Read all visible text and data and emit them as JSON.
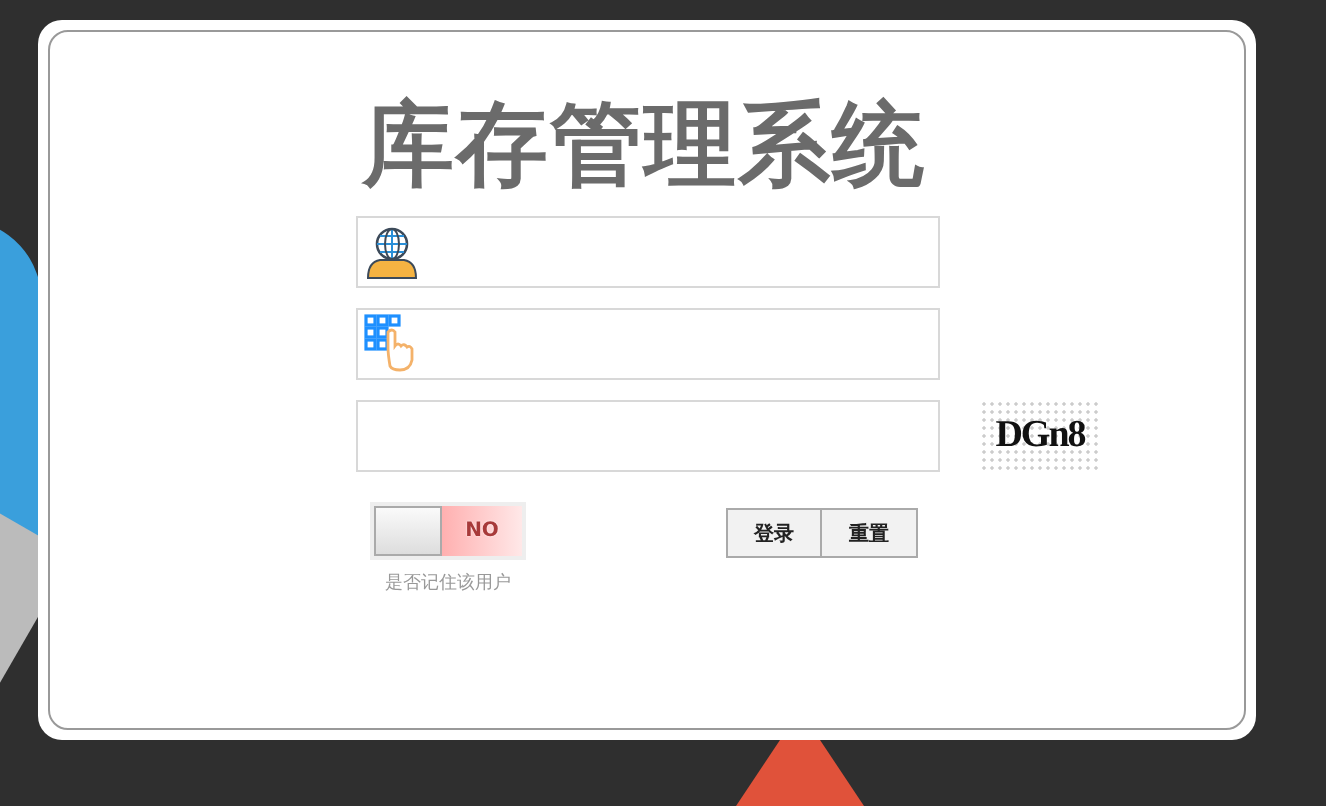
{
  "title": "库存管理系统",
  "fields": [
    {
      "kind": "user"
    },
    {
      "kind": "password"
    },
    {
      "kind": "code"
    }
  ],
  "captcha": "DGn8",
  "remember": {
    "on": false,
    "label": "NO",
    "caption": "是否记住该用户"
  },
  "buttons": [
    "登录",
    "重置"
  ]
}
